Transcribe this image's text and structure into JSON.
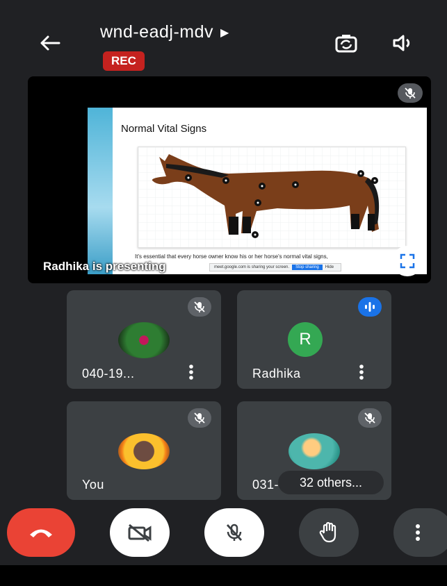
{
  "header": {
    "meeting_code": "wnd-eadj-mdv",
    "rec_label": "REC"
  },
  "presentation": {
    "presenter_label": "Radhika is presenting",
    "slide_title": "Normal Vital Signs",
    "slide_text": "It's essential that every horse owner know his or her horse's normal vital signs,",
    "share_bar_text": "meet.google.com is sharing your screen.",
    "stop_sharing_label": "Stop sharing",
    "hide_label": "Hide"
  },
  "participants": [
    {
      "name": "040-19...",
      "muted": true
    },
    {
      "name": "Radhika",
      "muted": false,
      "initial": "R"
    },
    {
      "name": "You",
      "muted": true
    },
    {
      "name": "031-",
      "muted": true
    }
  ],
  "others_label": "32 others..."
}
